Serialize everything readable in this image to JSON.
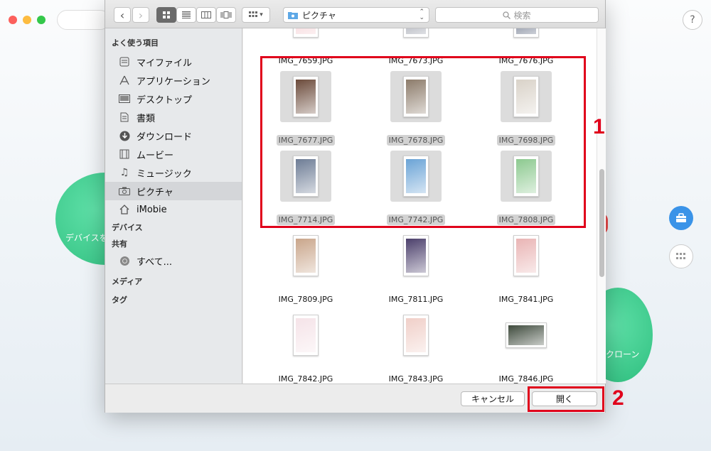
{
  "background": {
    "circle_left_label": "デバイスを",
    "circle_right_label": "クローン",
    "help_label": "?"
  },
  "toolbar": {
    "back": "‹",
    "forward": "›",
    "location": "ピクチャ",
    "search_placeholder": "検索"
  },
  "sidebar": {
    "favorites_heading": "よく使う項目",
    "favorites": [
      {
        "label": "マイファイル",
        "icon": "all-files-icon"
      },
      {
        "label": "アプリケーション",
        "icon": "applications-icon"
      },
      {
        "label": "デスクトップ",
        "icon": "desktop-icon"
      },
      {
        "label": "書類",
        "icon": "documents-icon"
      },
      {
        "label": "ダウンロード",
        "icon": "downloads-icon"
      },
      {
        "label": "ムービー",
        "icon": "movies-icon"
      },
      {
        "label": "ミュージック",
        "icon": "music-icon"
      },
      {
        "label": "ピクチャ",
        "icon": "camera-icon"
      },
      {
        "label": "iMobie",
        "icon": "home-icon"
      }
    ],
    "devices_heading": "デバイス",
    "shared_heading": "共有",
    "shared": [
      {
        "label": "すべて...",
        "icon": "network-icon"
      }
    ],
    "media_heading": "メディア",
    "tags_heading": "タグ"
  },
  "files": [
    {
      "name": "IMG_7659.JPG",
      "selected": false,
      "color": "#f3c7cc"
    },
    {
      "name": "IMG_7673.JPG",
      "selected": false,
      "color": "#8a8f9c"
    },
    {
      "name": "IMG_7676.JPG",
      "selected": false,
      "color": "#4a5670"
    },
    {
      "name": "IMG_7677.JPG",
      "selected": true,
      "color": "#6b4a3a"
    },
    {
      "name": "IMG_7678.JPG",
      "selected": true,
      "color": "#8c7b6a"
    },
    {
      "name": "IMG_7698.JPG",
      "selected": true,
      "color": "#d9d2c8"
    },
    {
      "name": "IMG_7714.JPG",
      "selected": true,
      "color": "#6d7c95"
    },
    {
      "name": "IMG_7742.JPG",
      "selected": true,
      "color": "#6aa3d6"
    },
    {
      "name": "IMG_7808.JPG",
      "selected": true,
      "color": "#8cc98f"
    },
    {
      "name": "IMG_7809.JPG",
      "selected": false,
      "color": "#c9a58a"
    },
    {
      "name": "IMG_7811.JPG",
      "selected": false,
      "color": "#4b3f6b"
    },
    {
      "name": "IMG_7841.JPG",
      "selected": false,
      "color": "#e9b4b4"
    },
    {
      "name": "IMG_7842.JPG",
      "selected": false,
      "color": "#f5e3e8"
    },
    {
      "name": "IMG_7843.JPG",
      "selected": false,
      "color": "#f0cfc8"
    },
    {
      "name": "IMG_7846.JPG",
      "selected": false,
      "color": "#3e4a3c",
      "wide": true
    }
  ],
  "buttons": {
    "cancel": "キャンセル",
    "open": "開く"
  },
  "annotations": {
    "one": "1",
    "two": "2"
  }
}
